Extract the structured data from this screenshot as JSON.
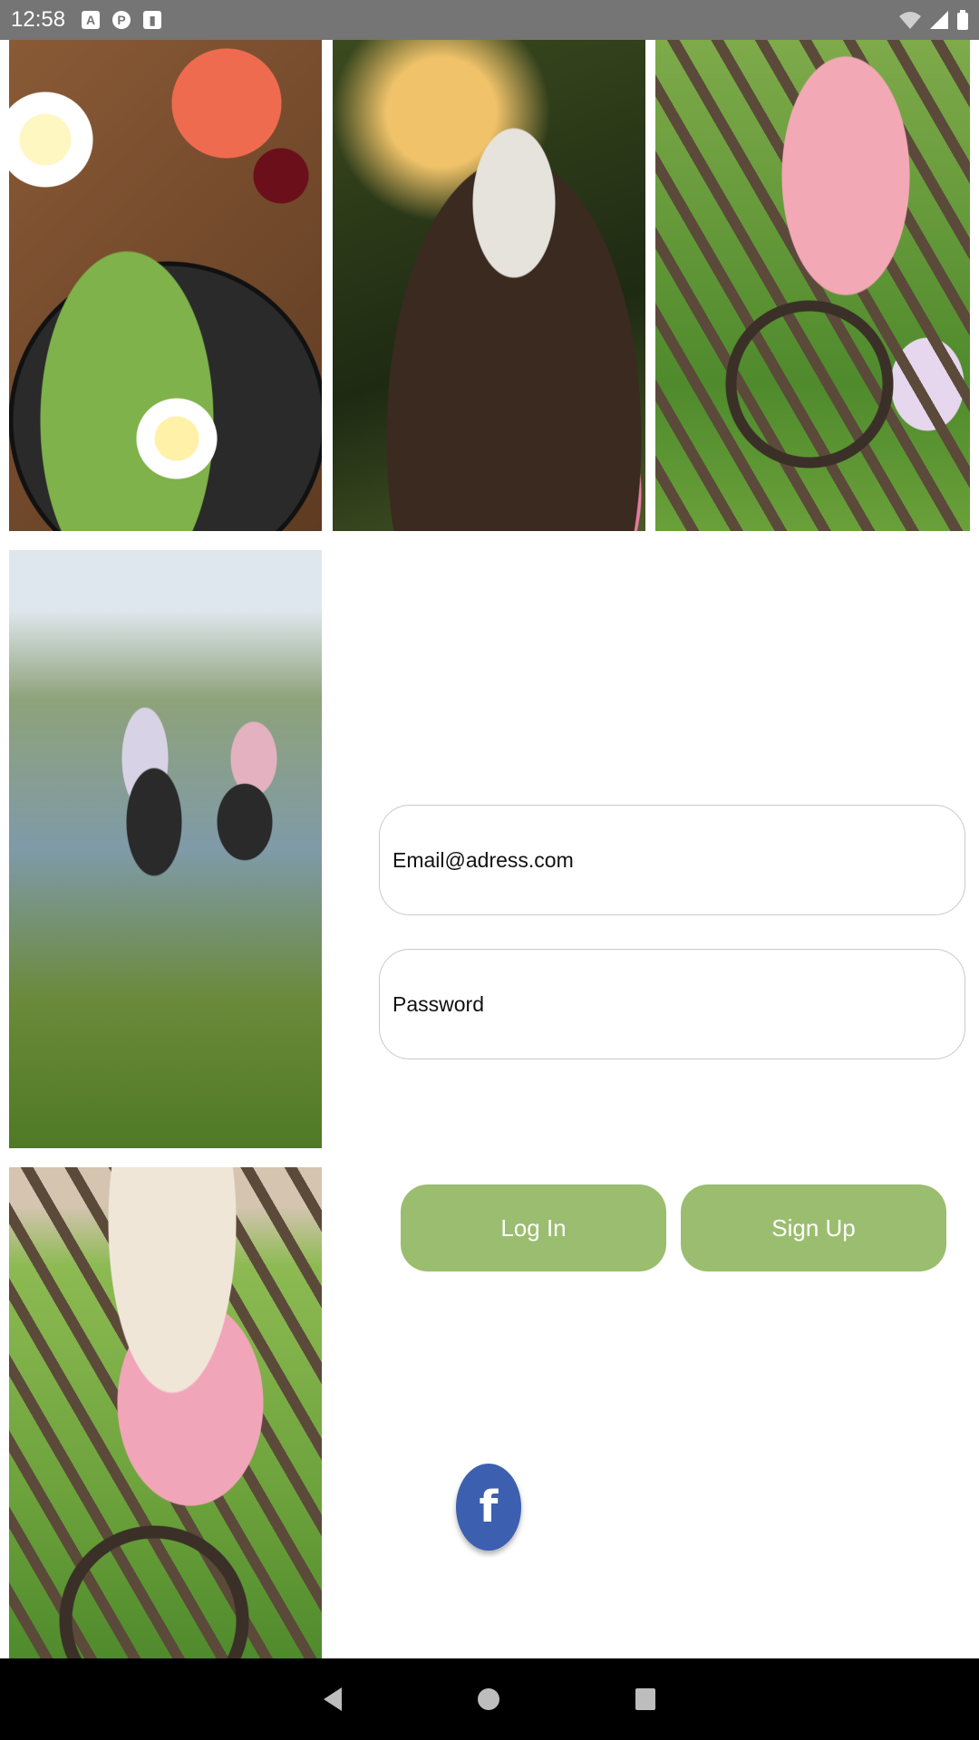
{
  "status_bar": {
    "time": "12:58",
    "icons_left": [
      "a-badge-icon",
      "p-badge-icon",
      "sd-card-icon"
    ],
    "icons_right": [
      "wifi-off-icon",
      "signal-icon",
      "battery-icon"
    ]
  },
  "photos": [
    {
      "name": "photo-healthy-food",
      "subject": "food bowl"
    },
    {
      "name": "photo-meditation",
      "subject": "meditation"
    },
    {
      "name": "photo-girl-reading-top",
      "subject": "girl reading"
    },
    {
      "name": "photo-hikers",
      "subject": "hikers"
    },
    {
      "name": "photo-girl-reading-bottom",
      "subject": "girl reading"
    }
  ],
  "login_form": {
    "email_placeholder": "Email@adress.com",
    "password_placeholder": "Password"
  },
  "buttons": {
    "login_label": "Log In",
    "signup_label": "Sign Up",
    "facebook_glyph": "f"
  },
  "colors": {
    "status_bar": "#757575",
    "button_green": "#9bbd6f",
    "facebook_blue": "#3d5fb0",
    "nav_bar": "#000000"
  },
  "nav_bar": {
    "icons": [
      "back-icon",
      "home-icon",
      "recents-icon"
    ]
  }
}
